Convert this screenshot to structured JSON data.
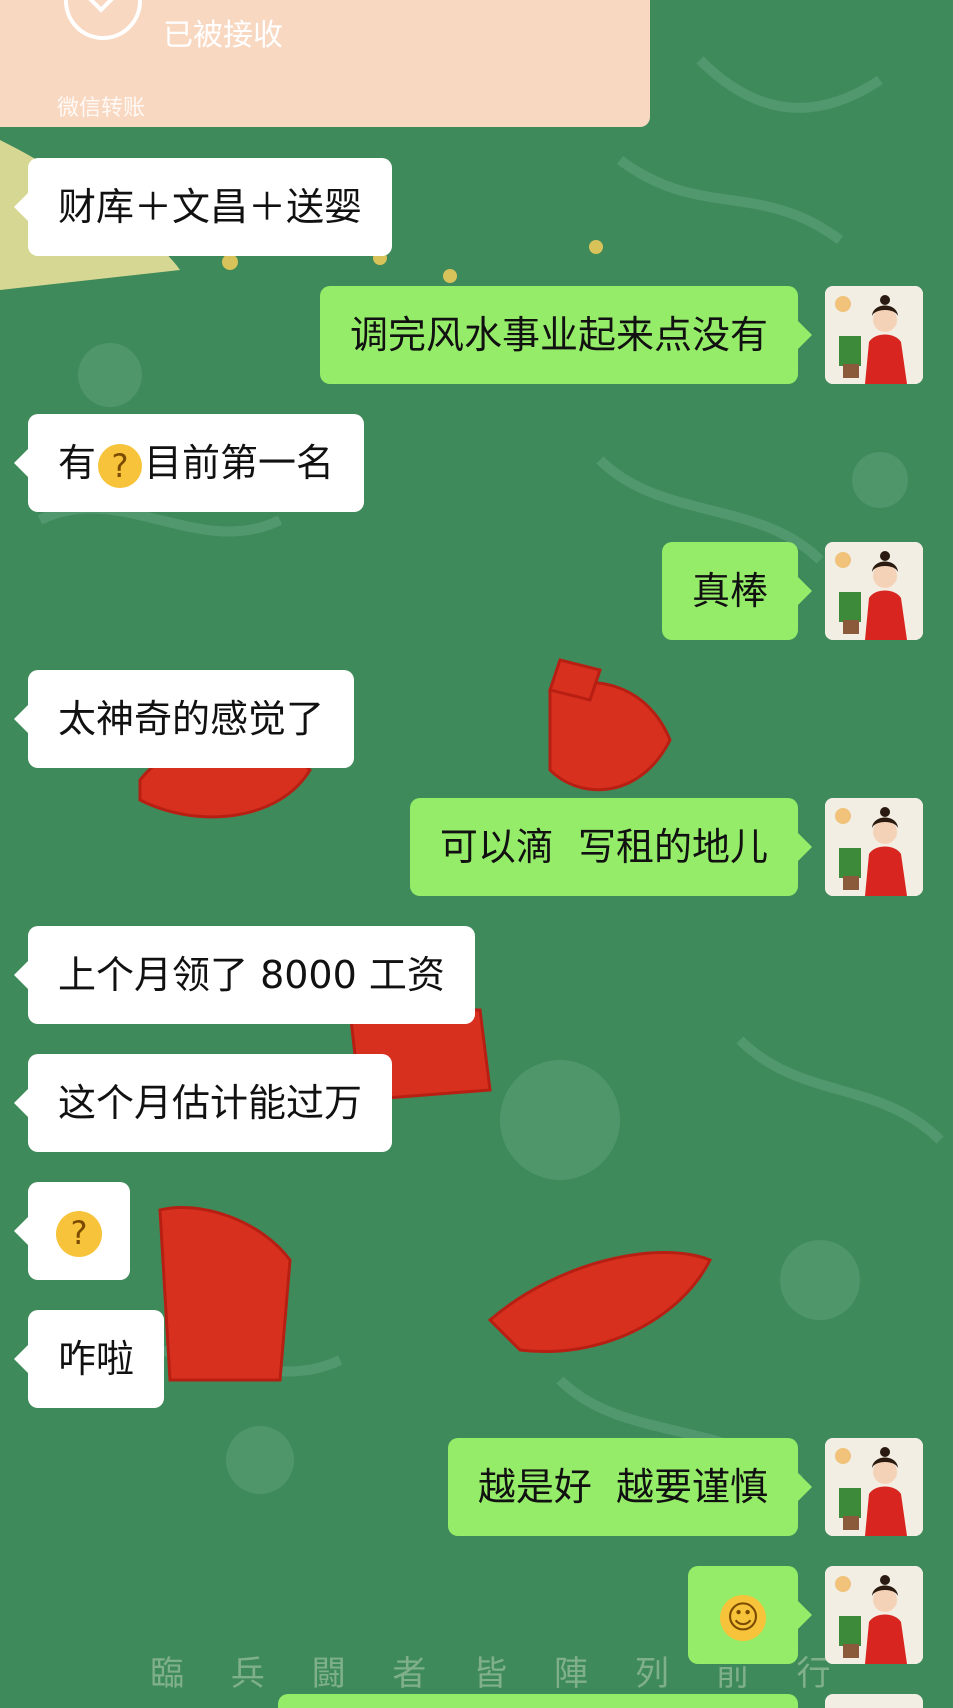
{
  "transfer": {
    "status": "已被接收",
    "label": "微信转账"
  },
  "messages": [
    {
      "side": "in",
      "text": "财库＋文昌＋送婴"
    },
    {
      "side": "out",
      "text": "调完风水事业起来点没有"
    },
    {
      "side": "in",
      "text_before": "有",
      "emoji": "thinking-face-emoji",
      "text_after": "目前第一名"
    },
    {
      "side": "out",
      "text": "真棒"
    },
    {
      "side": "in",
      "text": "太神奇的感觉了"
    },
    {
      "side": "out",
      "text": "可以滴  写租的地儿"
    },
    {
      "side": "in",
      "text": "上个月领了 8000 工资"
    },
    {
      "side": "in",
      "text": "这个月估计能过万"
    },
    {
      "side": "in",
      "emoji": "thinking-face-emoji"
    },
    {
      "side": "in",
      "text": "咋啦"
    },
    {
      "side": "out",
      "text": "越是好  越要谨慎"
    },
    {
      "side": "out",
      "emoji": "grinning-face-emoji"
    }
  ],
  "background_caption": "臨 兵 闘 者 皆 陣 列 前 行",
  "colors": {
    "background": "#3f8a5b",
    "incoming": "#ffffff",
    "outgoing": "#95ec69",
    "transfer": "#f9d8c2"
  }
}
